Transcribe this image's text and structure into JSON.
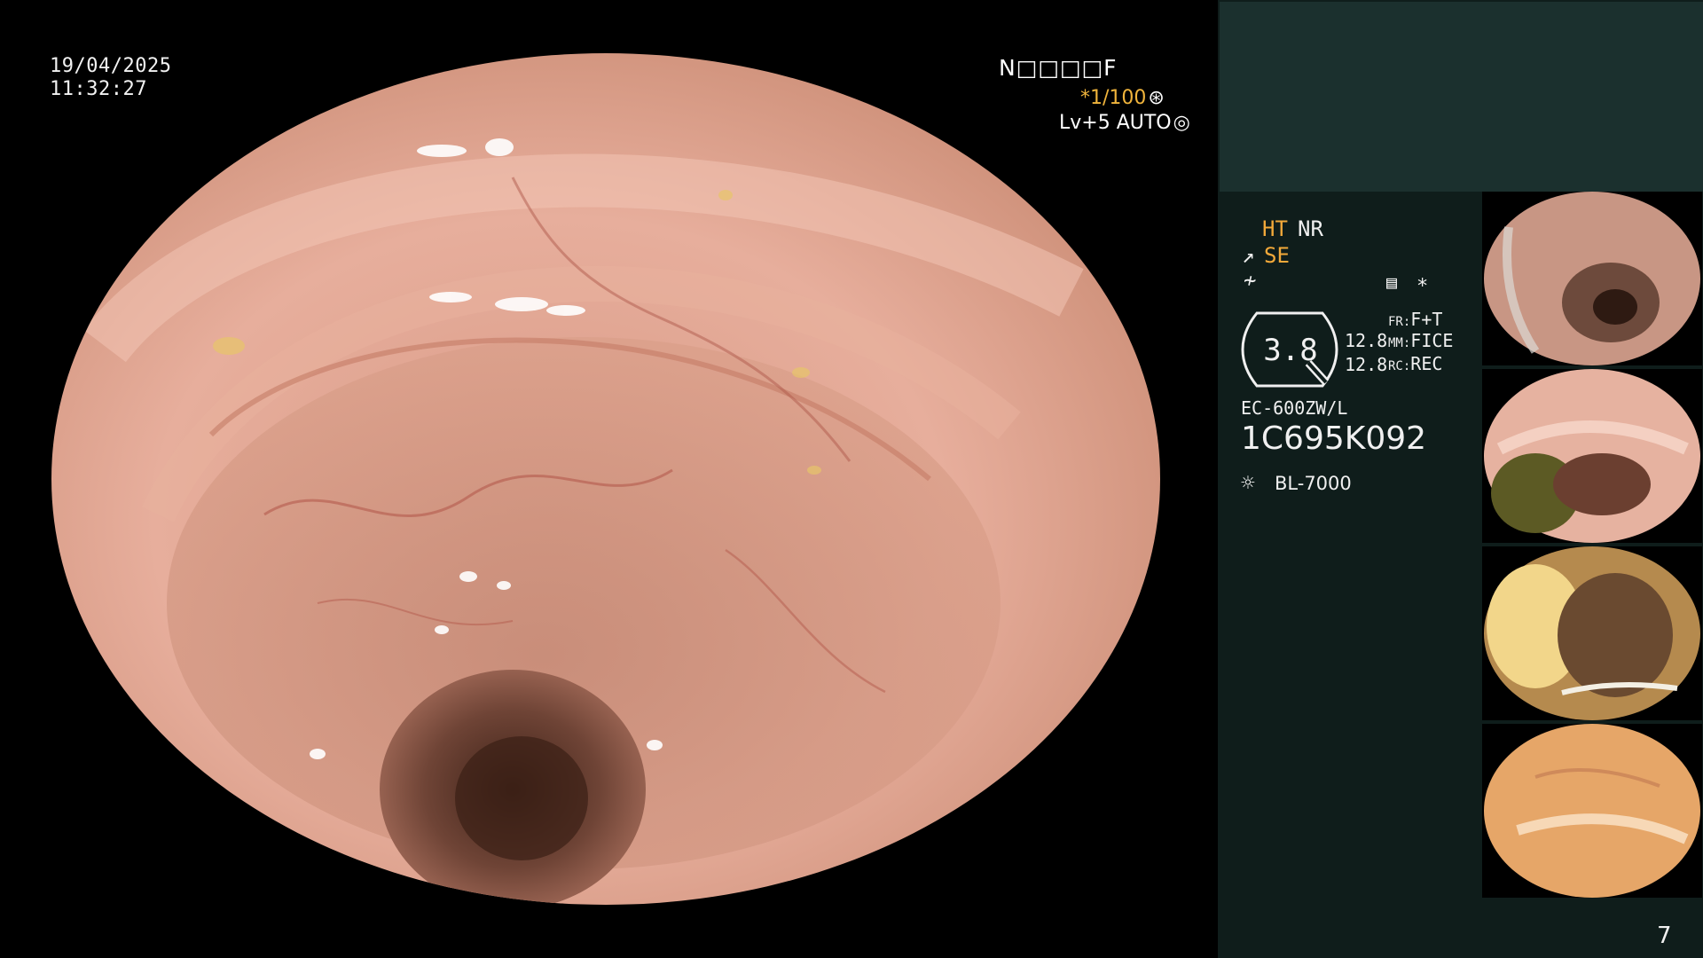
{
  "overlay": {
    "date": "19/04/2025",
    "time": "11:32:27",
    "status_code": "N□□□□F",
    "shutter": "*1/100",
    "light_level": "Lv+5 AUTO"
  },
  "panel": {
    "mode_ht": "HT",
    "mode_nr": "NR",
    "mode_se": "SE",
    "zoom_value": "3.8",
    "value_a": "12.8",
    "value_b": "12.8",
    "fr_key": "FR:",
    "fr_val": "F+T",
    "mm_key": "MM:",
    "mm_val": "FICE",
    "rc_key": "RC:",
    "rc_val": "REC",
    "scope_model": "EC-600ZW/L",
    "scope_serial": "1C695K092",
    "light_source": "BL-7000",
    "page_number": "7"
  },
  "icons": [
    "shutter-settings-icon",
    "auto-iris-icon",
    "enhancement-icon",
    "filter-icon",
    "storage-icon",
    "star-icon",
    "light-source-icon"
  ],
  "colors": {
    "accent": "#f2a93a",
    "panel_bg": "#0f1d1b",
    "panel_top": "#1b302e"
  }
}
